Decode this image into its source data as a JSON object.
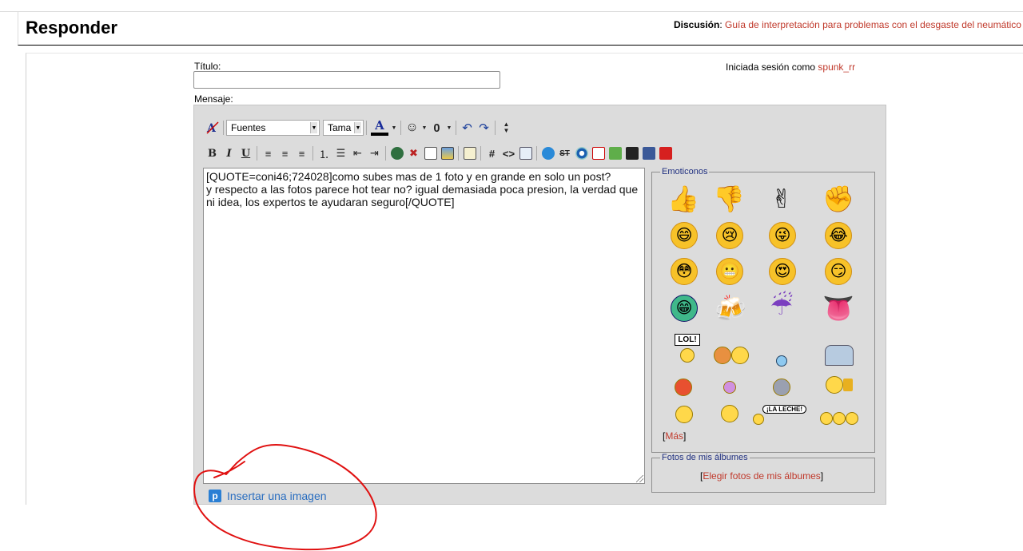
{
  "header": {
    "title": "Responder",
    "discussion_label": "Discusión",
    "discussion_link": "Guía de interpretación para problemas con el desgaste del neumático"
  },
  "form": {
    "title_label": "Título:",
    "message_label": "Mensaje:",
    "login_prefix": "Iniciada sesión como",
    "login_user": "spunk_rr"
  },
  "toolbar": {
    "font_select": "Fuentes",
    "size_select": "Tama"
  },
  "editor": {
    "text": "[QUOTE=coni46;724028]como subes mas de 1 foto y en grande en solo un post?\ny respecto a las fotos parece hot tear no? igual demasiada poca presion, la verdad que ni idea, los expertos te ayudaran seguro[/QUOTE]"
  },
  "emoticons": {
    "legend": "Emoticonos",
    "more_open": "[",
    "more_link": "Más",
    "more_close": "]",
    "lol_sign": "LOL!",
    "leche_bubble": "¡LA LECHE!"
  },
  "albums": {
    "legend": "Fotos de mis álbumes",
    "link_open": "[",
    "link": "Elegir fotos de mis álbumes",
    "link_close": "]"
  },
  "insert_image": {
    "icon_letter": "p",
    "label": "Insertar una imagen"
  },
  "colors": {
    "link": "#c0392b",
    "editor_bg": "#dcdcdc",
    "legend": "#203080",
    "insert_link": "#2a6ec0",
    "annotation": "#e01010"
  }
}
